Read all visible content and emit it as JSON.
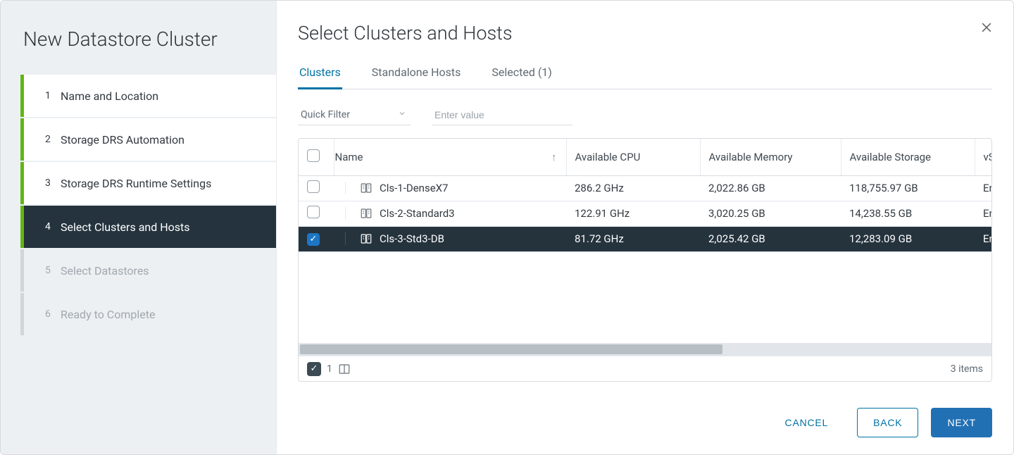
{
  "wizard": {
    "title": "New Datastore Cluster",
    "steps": [
      {
        "num": "1",
        "label": "Name and Location",
        "state": "done"
      },
      {
        "num": "2",
        "label": "Storage DRS Automation",
        "state": "done"
      },
      {
        "num": "3",
        "label": "Storage DRS Runtime Settings",
        "state": "done"
      },
      {
        "num": "4",
        "label": "Select Clusters and Hosts",
        "state": "current"
      },
      {
        "num": "5",
        "label": "Select Datastores",
        "state": "future"
      },
      {
        "num": "6",
        "label": "Ready to Complete",
        "state": "future"
      }
    ]
  },
  "main": {
    "title": "Select Clusters and Hosts",
    "tabs": [
      {
        "label": "Clusters",
        "active": true
      },
      {
        "label": "Standalone Hosts",
        "active": false
      },
      {
        "label": "Selected (1)",
        "active": false
      }
    ],
    "filter": {
      "quick_label": "Quick Filter",
      "placeholder": "Enter value"
    },
    "columns": {
      "name": "Name",
      "cpu": "Available CPU",
      "mem": "Available Memory",
      "sto": "Available Storage",
      "vsp": "vSphe"
    },
    "rows": [
      {
        "checked": false,
        "name": "Cls-1-DenseX7",
        "cpu": "286.2 GHz",
        "mem": "2,022.86 GB",
        "sto": "118,755.97 GB",
        "vsp": "Enabl"
      },
      {
        "checked": false,
        "name": "Cls-2-Standard3",
        "cpu": "122.91 GHz",
        "mem": "3,020.25 GB",
        "sto": "14,238.55 GB",
        "vsp": "Enabl"
      },
      {
        "checked": true,
        "name": "Cls-3-Std3-DB",
        "cpu": "81.72 GHz",
        "mem": "2,025.42 GB",
        "sto": "12,283.09 GB",
        "vsp": "Enabl"
      }
    ],
    "footer": {
      "selected_count": "1",
      "total_text": "3 items"
    },
    "actions": {
      "cancel": "CANCEL",
      "back": "BACK",
      "next": "NEXT"
    }
  }
}
